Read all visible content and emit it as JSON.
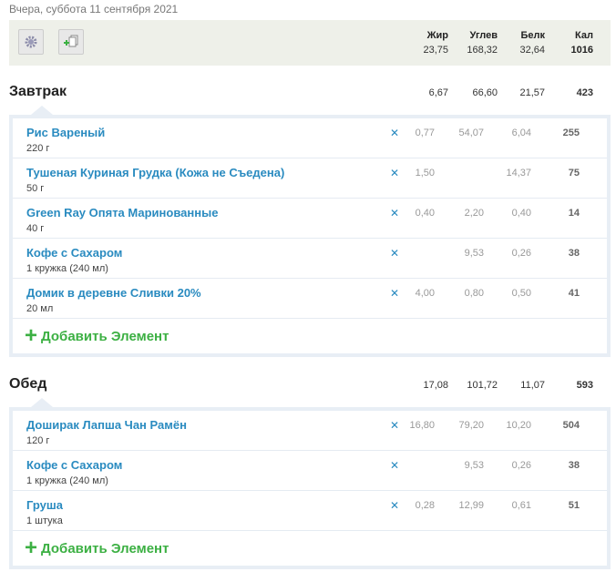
{
  "date": "Вчера, суббота 11 сентября 2021",
  "headers": {
    "fat": "Жир",
    "carb": "Углев",
    "prot": "Белк",
    "kcal": "Кал"
  },
  "totals": {
    "fat": "23,75",
    "carb": "168,32",
    "prot": "32,64",
    "kcal": "1016"
  },
  "add_label": "Добавить Элемент",
  "meals": [
    {
      "title": "Завтрак",
      "fat": "6,67",
      "carb": "66,60",
      "prot": "21,57",
      "kcal": "423",
      "items": [
        {
          "name": "Рис Вареный",
          "qty": "220 г",
          "fat": "0,77",
          "carb": "54,07",
          "prot": "6,04",
          "kcal": "255"
        },
        {
          "name": "Тушеная Куриная Грудка (Кожа не Съедена)",
          "qty": "50 г",
          "fat": "1,50",
          "carb": "",
          "prot": "14,37",
          "kcal": "75"
        },
        {
          "name": "Green Ray Опята Маринованные",
          "qty": "40 г",
          "fat": "0,40",
          "carb": "2,20",
          "prot": "0,40",
          "kcal": "14"
        },
        {
          "name": "Кофе с Сахаром",
          "qty": "1 кружка (240 мл)",
          "fat": "",
          "carb": "9,53",
          "prot": "0,26",
          "kcal": "38"
        },
        {
          "name": "Домик в деревне Сливки 20%",
          "qty": "20 мл",
          "fat": "4,00",
          "carb": "0,80",
          "prot": "0,50",
          "kcal": "41"
        }
      ]
    },
    {
      "title": "Обед",
      "fat": "17,08",
      "carb": "101,72",
      "prot": "11,07",
      "kcal": "593",
      "items": [
        {
          "name": "Доширак Лапша Чан Рамён",
          "qty": "120 г",
          "fat": "16,80",
          "carb": "79,20",
          "prot": "10,20",
          "kcal": "504"
        },
        {
          "name": "Кофе с Сахаром",
          "qty": "1 кружка (240 мл)",
          "fat": "",
          "carb": "9,53",
          "prot": "0,26",
          "kcal": "38"
        },
        {
          "name": "Груша",
          "qty": "1 штука",
          "fat": "0,28",
          "carb": "12,99",
          "prot": "0,61",
          "kcal": "51"
        }
      ]
    }
  ]
}
